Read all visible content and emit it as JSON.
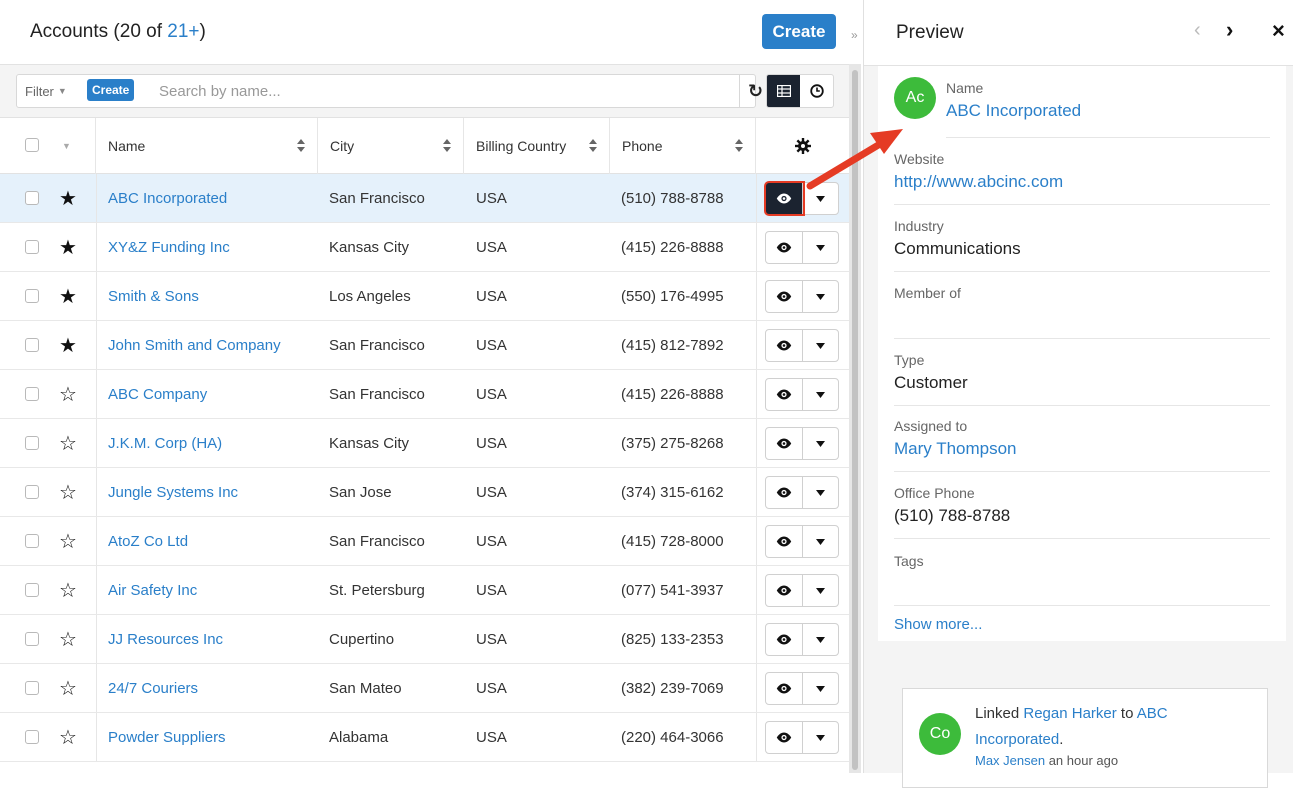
{
  "list": {
    "title_prefix": "Accounts (20 of ",
    "title_count": "21+",
    "title_suffix": ")",
    "create_label": "Create",
    "collapse_icon": "double-chevron-right"
  },
  "filter": {
    "label": "Filter",
    "create_label": "Create",
    "search_placeholder": "Search by name...",
    "search_value": ""
  },
  "columns": [
    "Name",
    "City",
    "Billing Country",
    "Phone"
  ],
  "rows": [
    {
      "name": "ABC Incorporated",
      "city": "San Francisco",
      "country": "USA",
      "phone": "(510) 788-8788",
      "favorite": true,
      "selected": true
    },
    {
      "name": "XY&Z Funding Inc",
      "city": "Kansas City",
      "country": "USA",
      "phone": "(415) 226-8888",
      "favorite": true,
      "selected": false
    },
    {
      "name": "Smith & Sons",
      "city": "Los Angeles",
      "country": "USA",
      "phone": "(550) 176-4995",
      "favorite": true,
      "selected": false
    },
    {
      "name": "John Smith and Company",
      "city": "San Francisco",
      "country": "USA",
      "phone": "(415) 812-7892",
      "favorite": true,
      "selected": false
    },
    {
      "name": "ABC Company",
      "city": "San Francisco",
      "country": "USA",
      "phone": "(415) 226-8888",
      "favorite": false,
      "selected": false
    },
    {
      "name": "J.K.M. Corp (HA)",
      "city": "Kansas City",
      "country": "USA",
      "phone": "(375) 275-8268",
      "favorite": false,
      "selected": false
    },
    {
      "name": "Jungle Systems Inc",
      "city": "San Jose",
      "country": "USA",
      "phone": "(374) 315-6162",
      "favorite": false,
      "selected": false
    },
    {
      "name": "AtoZ Co Ltd",
      "city": "San Francisco",
      "country": "USA",
      "phone": "(415) 728-8000",
      "favorite": false,
      "selected": false
    },
    {
      "name": "Air Safety Inc",
      "city": "St. Petersburg",
      "country": "USA",
      "phone": "(077) 541-3937",
      "favorite": false,
      "selected": false
    },
    {
      "name": "JJ Resources Inc",
      "city": "Cupertino",
      "country": "USA",
      "phone": "(825) 133-2353",
      "favorite": false,
      "selected": false
    },
    {
      "name": "24/7 Couriers",
      "city": "San Mateo",
      "country": "USA",
      "phone": "(382) 239-7069",
      "favorite": false,
      "selected": false
    },
    {
      "name": "Powder Suppliers",
      "city": "Alabama",
      "country": "USA",
      "phone": "(220) 464-3066",
      "favorite": false,
      "selected": false
    }
  ],
  "preview": {
    "title": "Preview",
    "avatar": "Ac",
    "fields": [
      {
        "label": "Name",
        "value": "ABC Incorporated",
        "link": true
      },
      {
        "label": "Website",
        "value": "http://www.abcinc.com",
        "link": true
      },
      {
        "label": "Industry",
        "value": "Communications",
        "link": false
      },
      {
        "label": "Member of",
        "value": "",
        "link": false
      },
      {
        "label": "Type",
        "value": "Customer",
        "link": false
      },
      {
        "label": "Assigned to",
        "value": "Mary Thompson",
        "link": true
      },
      {
        "label": "Office Phone",
        "value": "(510) 788-8788",
        "link": false
      },
      {
        "label": "Tags",
        "value": "",
        "link": false
      }
    ],
    "show_more": "Show more..."
  },
  "activity": {
    "avatar": "Co",
    "text_linked": "Linked ",
    "contact": "Regan Harker",
    "text_to": " to ",
    "account": "ABC Incorporated",
    "period": ".",
    "author": "Max Jensen",
    "time": " an hour ago"
  },
  "colors": {
    "accent": "#2a7fc9",
    "selected_row": "#e5f1fb",
    "dark_button": "#1b2330",
    "highlight": "#e53b24",
    "avatar": "#3dbb3b"
  }
}
